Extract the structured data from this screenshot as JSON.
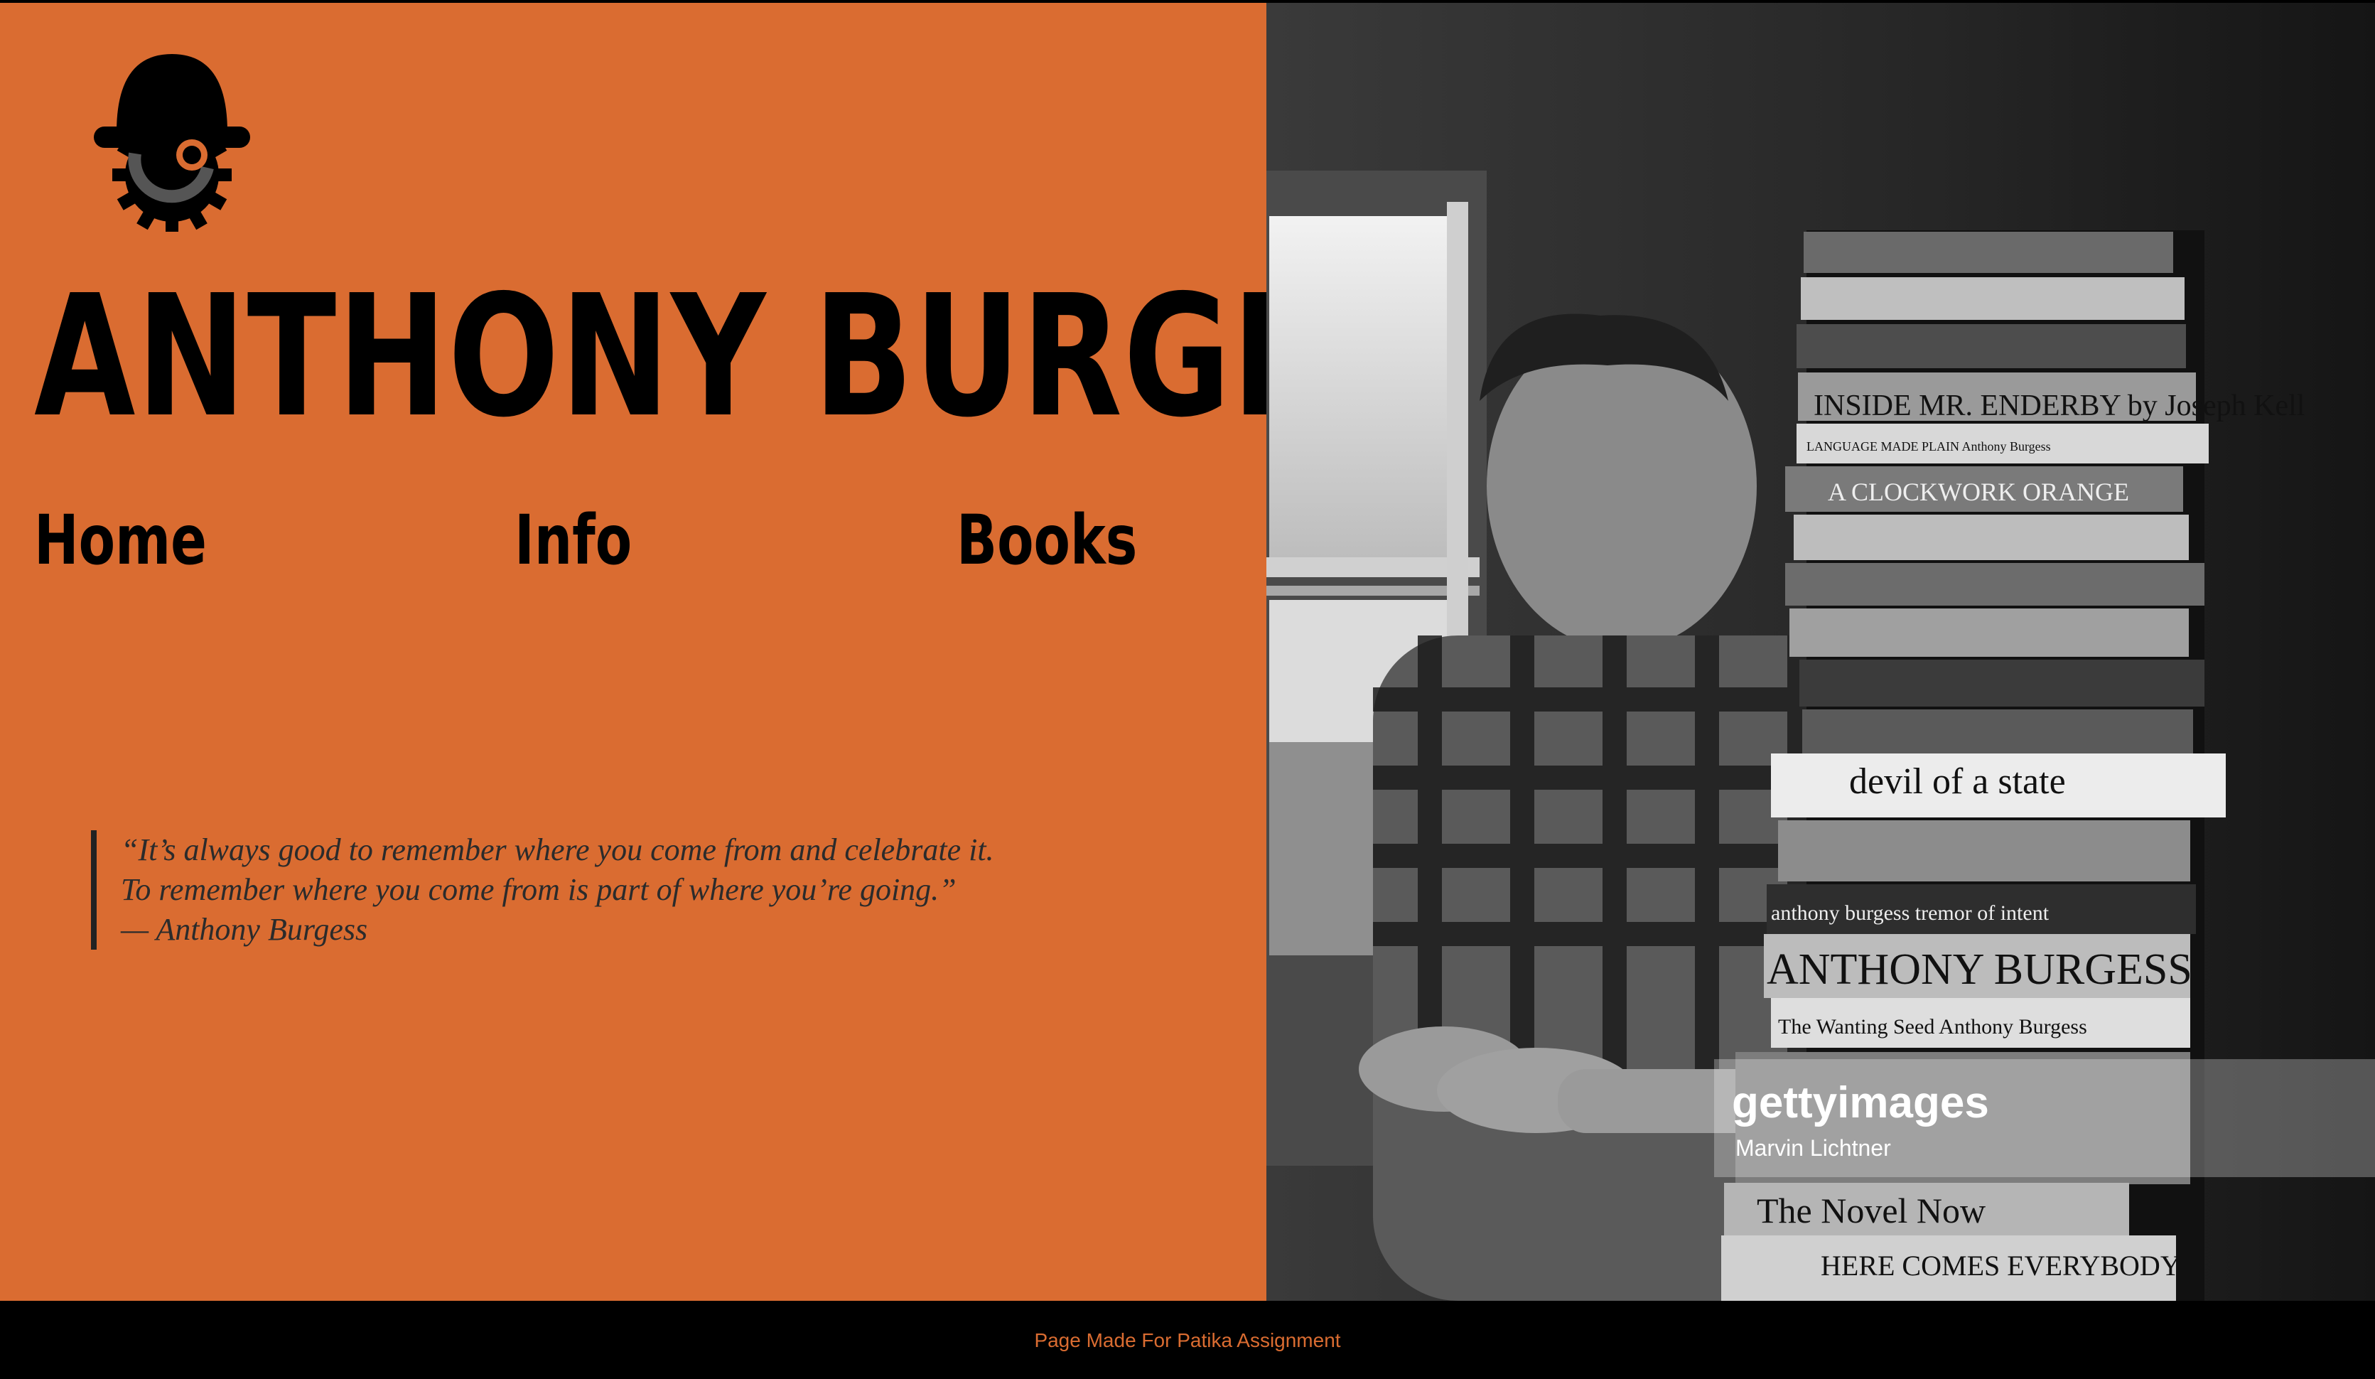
{
  "site": {
    "title": "ANTHONY BURGESS",
    "logo_icon": "bowler-hat-cog-eye-icon"
  },
  "nav": {
    "items": [
      {
        "label": "Home"
      },
      {
        "label": "Info"
      },
      {
        "label": "Books"
      }
    ]
  },
  "quote": {
    "line1": "“It’s always good to remember where you come from and celebrate it.",
    "line2": "To remember where you come from is part of where you’re going.”",
    "attribution": "— Anthony Burgess"
  },
  "photo": {
    "watermark_brand": "gettyimages",
    "photographer": "Marvin Lichtner",
    "book_spines": [
      "INSIDE MR. ENDERBY by Joseph Kell",
      "LANGUAGE MADE PLAIN   Anthony Burgess",
      "A CLOCKWORK ORANGE",
      "devil of a state",
      "anthony burgess  tremor of intent",
      "ANTHONY BURGESS",
      "The Wanting Seed   Anthony Burgess",
      "The Novel Now",
      "HERE COMES EVERYBODY"
    ]
  },
  "footer": {
    "text": "Page Made For Patika Assignment"
  },
  "colors": {
    "accent": "#DA6C31",
    "background": "#000000",
    "text": "#000000"
  }
}
